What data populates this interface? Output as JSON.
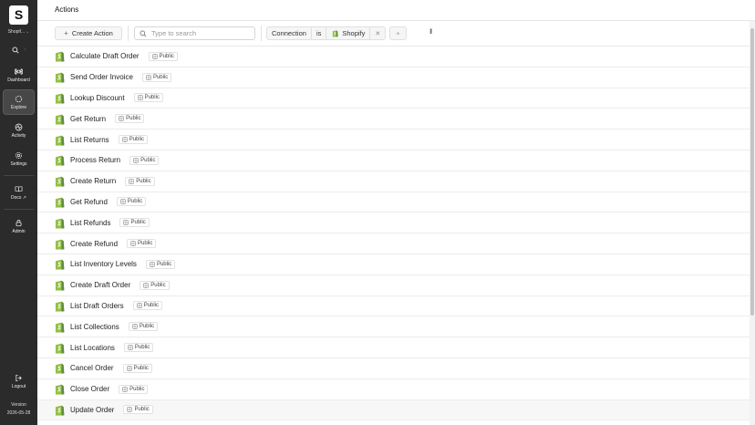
{
  "workspace": {
    "logo_letter": "S",
    "name": "Shopif..."
  },
  "sidebar": {
    "items": [
      {
        "label": "Dashboard",
        "icon": "command-icon"
      },
      {
        "label": "Explore",
        "icon": "explore-icon",
        "active": true
      },
      {
        "label": "Activity",
        "icon": "activity-icon"
      },
      {
        "label": "Settings",
        "icon": "gear-icon"
      },
      {
        "label": "Docs ↗",
        "icon": "book-icon"
      },
      {
        "label": "Admin",
        "icon": "lock-icon"
      },
      {
        "label": "Logout",
        "icon": "logout-icon"
      }
    ],
    "version_label": "Version",
    "version_value": "2026-05-28"
  },
  "header": {
    "title": "Actions"
  },
  "toolbar": {
    "create_label": "Create Action",
    "search_placeholder": "Type to search",
    "filter": {
      "field": "Connection",
      "operator": "is",
      "value": "Shopify"
    }
  },
  "actions": [
    {
      "name": "Calculate Draft Order",
      "visibility": "Public"
    },
    {
      "name": "Send Order Invoice",
      "visibility": "Public"
    },
    {
      "name": "Lookup Discount",
      "visibility": "Public"
    },
    {
      "name": "Get Return",
      "visibility": "Public"
    },
    {
      "name": "List Returns",
      "visibility": "Public"
    },
    {
      "name": "Process Return",
      "visibility": "Public"
    },
    {
      "name": "Create Return",
      "visibility": "Public"
    },
    {
      "name": "Get Refund",
      "visibility": "Public"
    },
    {
      "name": "List Refunds",
      "visibility": "Public"
    },
    {
      "name": "Create Refund",
      "visibility": "Public"
    },
    {
      "name": "List Inventory Levels",
      "visibility": "Public"
    },
    {
      "name": "Create Draft Order",
      "visibility": "Public"
    },
    {
      "name": "List Draft Orders",
      "visibility": "Public"
    },
    {
      "name": "List Collections",
      "visibility": "Public"
    },
    {
      "name": "List Locations",
      "visibility": "Public"
    },
    {
      "name": "Cancel Order",
      "visibility": "Public"
    },
    {
      "name": "Close Order",
      "visibility": "Public"
    },
    {
      "name": "Update Order",
      "visibility": "Public"
    }
  ],
  "colors": {
    "sidebar_bg": "#2b2b2b",
    "shopify_green": "#5e8e3e",
    "shopify_light": "#95bf47"
  }
}
